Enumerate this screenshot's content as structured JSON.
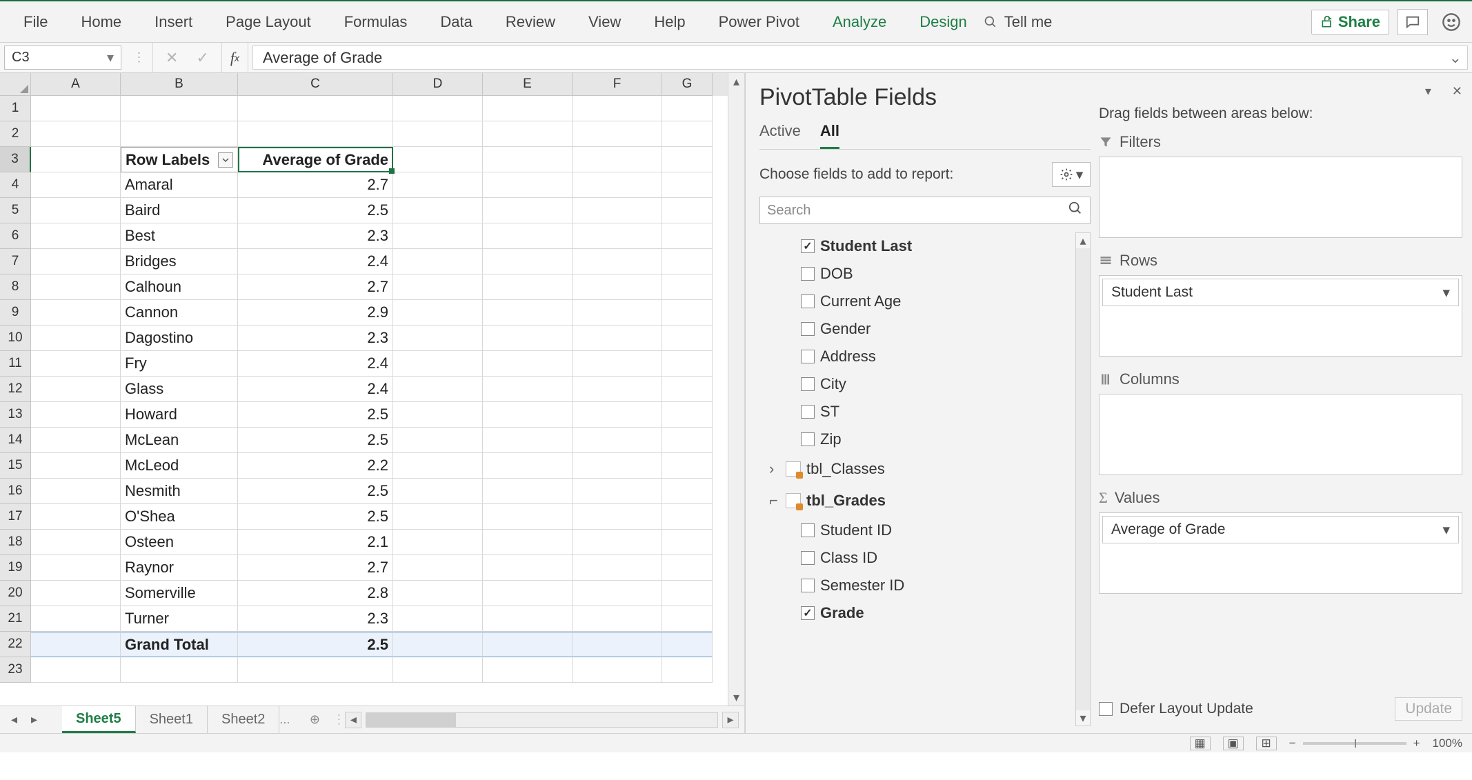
{
  "ribbon": {
    "tabs": [
      "File",
      "Home",
      "Insert",
      "Page Layout",
      "Formulas",
      "Data",
      "Review",
      "View",
      "Help",
      "Power Pivot",
      "Analyze",
      "Design"
    ],
    "tellme": "Tell me",
    "share": "Share"
  },
  "formula_bar": {
    "name_box": "C3",
    "content": "Average of Grade"
  },
  "columns": [
    "A",
    "B",
    "C",
    "D",
    "E",
    "F",
    "G"
  ],
  "row_numbers": [
    1,
    2,
    3,
    4,
    5,
    6,
    7,
    8,
    9,
    10,
    11,
    12,
    13,
    14,
    15,
    16,
    17,
    18,
    19,
    20,
    21,
    22,
    23
  ],
  "pivot": {
    "row_labels_header": "Row Labels",
    "value_header": "Average of Grade",
    "rows": [
      {
        "label": "Amaral",
        "val": "2.7"
      },
      {
        "label": "Baird",
        "val": "2.5"
      },
      {
        "label": "Best",
        "val": "2.3"
      },
      {
        "label": "Bridges",
        "val": "2.4"
      },
      {
        "label": "Calhoun",
        "val": "2.7"
      },
      {
        "label": "Cannon",
        "val": "2.9"
      },
      {
        "label": "Dagostino",
        "val": "2.3"
      },
      {
        "label": "Fry",
        "val": "2.4"
      },
      {
        "label": "Glass",
        "val": "2.4"
      },
      {
        "label": "Howard",
        "val": "2.5"
      },
      {
        "label": "McLean",
        "val": "2.5"
      },
      {
        "label": "McLeod",
        "val": "2.2"
      },
      {
        "label": "Nesmith",
        "val": "2.5"
      },
      {
        "label": "O'Shea",
        "val": "2.5"
      },
      {
        "label": "Osteen",
        "val": "2.1"
      },
      {
        "label": "Raynor",
        "val": "2.7"
      },
      {
        "label": "Somerville",
        "val": "2.8"
      },
      {
        "label": "Turner",
        "val": "2.3"
      }
    ],
    "grand_total_label": "Grand Total",
    "grand_total_val": "2.5"
  },
  "sheet_tabs": {
    "active": "Sheet5",
    "others": [
      "Sheet1",
      "Sheet2"
    ],
    "more": "..."
  },
  "pane": {
    "title": "PivotTable Fields",
    "tab_active": "Active",
    "tab_all": "All",
    "sub": "Choose fields to add to report:",
    "search_placeholder": "Search",
    "fields_group1": [
      {
        "name": "Student Last",
        "checked": true
      },
      {
        "name": "DOB",
        "checked": false
      },
      {
        "name": "Current Age",
        "checked": false
      },
      {
        "name": "Gender",
        "checked": false
      },
      {
        "name": "Address",
        "checked": false
      },
      {
        "name": "City",
        "checked": false
      },
      {
        "name": "ST",
        "checked": false
      },
      {
        "name": "Zip",
        "checked": false
      }
    ],
    "table_classes": "tbl_Classes",
    "table_grades": "tbl_Grades",
    "fields_group2": [
      {
        "name": "Student ID",
        "checked": false
      },
      {
        "name": "Class ID",
        "checked": false
      },
      {
        "name": "Semester ID",
        "checked": false
      },
      {
        "name": "Grade",
        "checked": true
      }
    ],
    "areas": {
      "instruction": "Drag fields between areas below:",
      "filters": "Filters",
      "rows": "Rows",
      "columns": "Columns",
      "values": "Values",
      "row_item": "Student Last",
      "value_item": "Average of Grade"
    },
    "defer": "Defer Layout Update",
    "update": "Update"
  },
  "status": {
    "zoom": "100%"
  }
}
